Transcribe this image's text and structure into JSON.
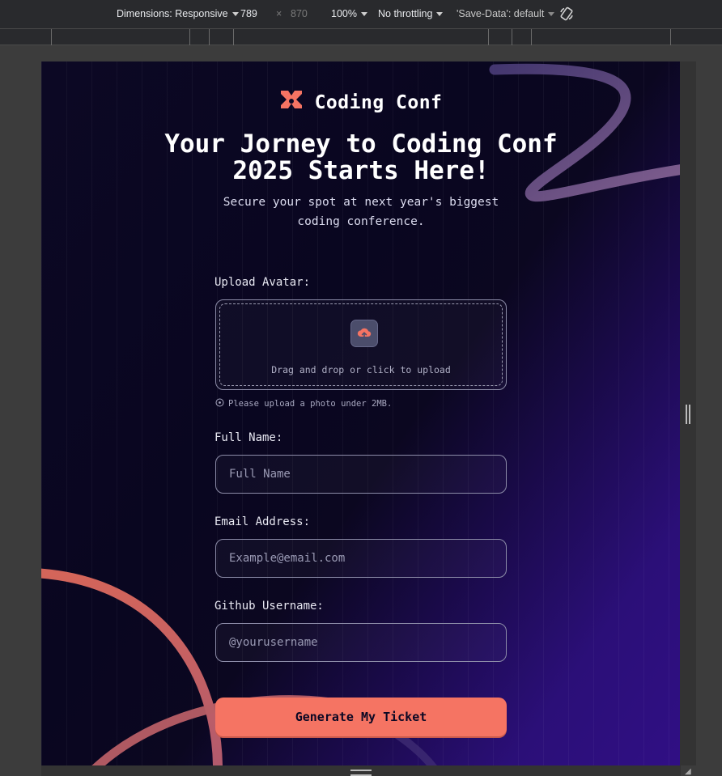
{
  "devtools": {
    "dimensions_label": "Dimensions: Responsive",
    "width": "789",
    "times": "×",
    "height": "870",
    "zoom": "100%",
    "throttling": "No throttling",
    "save_data": "'Save-Data': default"
  },
  "page": {
    "logo_text": "Coding Conf",
    "title": "Your Jorney to Coding Conf 2025 Starts Here!",
    "subtitle": "Secure your spot at next year's biggest coding conference.",
    "upload": {
      "label": "Upload Avatar:",
      "prompt": "Drag and drop or click to upload",
      "hint": "Please upload a photo under 2MB."
    },
    "fields": {
      "full_name": {
        "label": "Full Name:",
        "placeholder": "Full Name"
      },
      "email": {
        "label": "Email Address:",
        "placeholder": "Example@email.com"
      },
      "github": {
        "label": "Github Username:",
        "placeholder": "@yourusername"
      }
    },
    "submit_label": "Generate My Ticket"
  },
  "colors": {
    "accent": "#f57463",
    "background_dark": "#0c0824",
    "background_purple": "#300f84"
  }
}
